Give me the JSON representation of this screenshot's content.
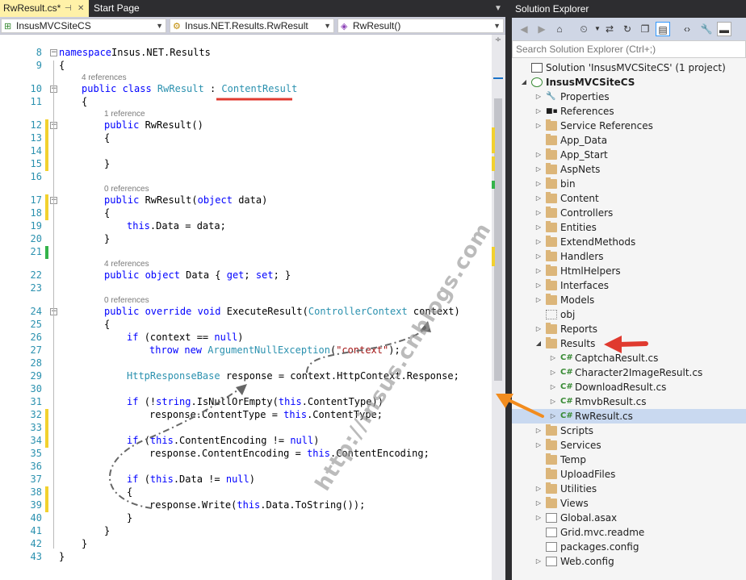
{
  "tabs": [
    {
      "label": "RwResult.cs*"
    },
    {
      "label": "Start Page"
    }
  ],
  "nav": {
    "project": "InsusMVCSiteCS",
    "class": "Insus.NET.Results.RwResult",
    "member": "RwResult()"
  },
  "code": [
    {
      "n": "8",
      "ind": 0,
      "seg": [
        [
          "kw",
          "namespace"
        ],
        [
          "",
          "Insus.NET.Results"
        ]
      ]
    },
    {
      "n": "9",
      "ind": 0,
      "seg": [
        [
          "",
          "{"
        ]
      ]
    },
    {
      "ref": "4 references",
      "ind": 1
    },
    {
      "n": "10",
      "ind": 1,
      "seg": [
        [
          "kw",
          "public class "
        ],
        [
          "ty",
          "RwResult"
        ],
        [
          "",
          " : "
        ],
        [
          "ty",
          "ContentResult"
        ]
      ]
    },
    {
      "n": "11",
      "ind": 1,
      "seg": [
        [
          "",
          "{"
        ]
      ]
    },
    {
      "ref": "1 reference",
      "ind": 2
    },
    {
      "n": "12",
      "ind": 2,
      "seg": [
        [
          "kw",
          "public "
        ],
        [
          "",
          "RwResult()"
        ]
      ]
    },
    {
      "n": "13",
      "ind": 2,
      "seg": [
        [
          "",
          "{"
        ]
      ]
    },
    {
      "n": "14",
      "ind": 2,
      "seg": []
    },
    {
      "n": "15",
      "ind": 2,
      "seg": [
        [
          "",
          "}"
        ]
      ]
    },
    {
      "n": "16",
      "ind": 2,
      "seg": []
    },
    {
      "ref": "0 references",
      "ind": 2
    },
    {
      "n": "17",
      "ind": 2,
      "seg": [
        [
          "kw",
          "public "
        ],
        [
          "",
          "RwResult("
        ],
        [
          "kw",
          "object"
        ],
        [
          "",
          " data)"
        ]
      ]
    },
    {
      "n": "18",
      "ind": 2,
      "seg": [
        [
          "",
          "{"
        ]
      ]
    },
    {
      "n": "19",
      "ind": 3,
      "seg": [
        [
          "kw",
          "this"
        ],
        [
          "",
          ".Data = data;"
        ]
      ]
    },
    {
      "n": "20",
      "ind": 2,
      "seg": [
        [
          "",
          "}"
        ]
      ]
    },
    {
      "n": "21",
      "ind": 2,
      "seg": []
    },
    {
      "ref": "4 references",
      "ind": 2
    },
    {
      "n": "22",
      "ind": 2,
      "seg": [
        [
          "kw",
          "public object "
        ],
        [
          "",
          "Data { "
        ],
        [
          "kw",
          "get"
        ],
        [
          "",
          "; "
        ],
        [
          "kw",
          "set"
        ],
        [
          "",
          "; }"
        ]
      ]
    },
    {
      "n": "23",
      "ind": 2,
      "seg": []
    },
    {
      "ref": "0 references",
      "ind": 2
    },
    {
      "n": "24",
      "ind": 2,
      "seg": [
        [
          "kw",
          "public override void "
        ],
        [
          "",
          "ExecuteResult("
        ],
        [
          "ty",
          "ControllerContext"
        ],
        [
          "",
          " context)"
        ]
      ]
    },
    {
      "n": "25",
      "ind": 2,
      "seg": [
        [
          "",
          "{"
        ]
      ]
    },
    {
      "n": "26",
      "ind": 3,
      "seg": [
        [
          "kw",
          "if "
        ],
        [
          "",
          "(context == "
        ],
        [
          "kw",
          "null"
        ],
        [
          "",
          ")"
        ]
      ]
    },
    {
      "n": "27",
      "ind": 4,
      "seg": [
        [
          "kw",
          "throw new "
        ],
        [
          "ty",
          "ArgumentNullException"
        ],
        [
          "",
          "("
        ],
        [
          "st",
          "\"context\""
        ],
        [
          "",
          ");"
        ]
      ]
    },
    {
      "n": "28",
      "ind": 3,
      "seg": []
    },
    {
      "n": "29",
      "ind": 3,
      "seg": [
        [
          "ty",
          "HttpResponseBase"
        ],
        [
          "",
          " response = context.HttpContext.Response;"
        ]
      ]
    },
    {
      "n": "30",
      "ind": 3,
      "seg": []
    },
    {
      "n": "31",
      "ind": 3,
      "seg": [
        [
          "kw",
          "if "
        ],
        [
          "",
          "(!"
        ],
        [
          "kw",
          "string"
        ],
        [
          "",
          ".IsNullOrEmpty("
        ],
        [
          "kw",
          "this"
        ],
        [
          "",
          ".ContentType))"
        ]
      ]
    },
    {
      "n": "32",
      "ind": 4,
      "seg": [
        [
          "",
          "response.ContentType = "
        ],
        [
          "kw",
          "this"
        ],
        [
          "",
          ".ContentType;"
        ]
      ]
    },
    {
      "n": "33",
      "ind": 3,
      "seg": []
    },
    {
      "n": "34",
      "ind": 3,
      "seg": [
        [
          "kw",
          "if "
        ],
        [
          "",
          "("
        ],
        [
          "kw",
          "this"
        ],
        [
          "",
          ".ContentEncoding != "
        ],
        [
          "kw",
          "null"
        ],
        [
          "",
          ")"
        ]
      ]
    },
    {
      "n": "35",
      "ind": 4,
      "seg": [
        [
          "",
          "response.ContentEncoding = "
        ],
        [
          "kw",
          "this"
        ],
        [
          "",
          ".ContentEncoding;"
        ]
      ]
    },
    {
      "n": "36",
      "ind": 3,
      "seg": []
    },
    {
      "n": "37",
      "ind": 3,
      "seg": [
        [
          "kw",
          "if "
        ],
        [
          "",
          "("
        ],
        [
          "kw",
          "this"
        ],
        [
          "",
          ".Data != "
        ],
        [
          "kw",
          "null"
        ],
        [
          "",
          ")"
        ]
      ]
    },
    {
      "n": "38",
      "ind": 3,
      "seg": [
        [
          "",
          "{"
        ]
      ]
    },
    {
      "n": "39",
      "ind": 4,
      "seg": [
        [
          "",
          "response.Write("
        ],
        [
          "kw",
          "this"
        ],
        [
          "",
          ".Data.ToString());"
        ]
      ]
    },
    {
      "n": "40",
      "ind": 3,
      "seg": [
        [
          "",
          "}"
        ]
      ]
    },
    {
      "n": "41",
      "ind": 2,
      "seg": [
        [
          "",
          "}"
        ]
      ]
    },
    {
      "n": "42",
      "ind": 1,
      "seg": [
        [
          "",
          "}"
        ]
      ]
    },
    {
      "n": "43",
      "ind": 0,
      "seg": [
        [
          "",
          "}"
        ]
      ]
    }
  ],
  "solution_explorer": {
    "title": "Solution Explorer",
    "search_placeholder": "Search Solution Explorer (Ctrl+;)",
    "items": [
      {
        "label": "Solution 'InsusMVCSiteCS' (1 project)",
        "level": 0,
        "icon": "solution-icon",
        "exp": ""
      },
      {
        "label": "InsusMVCSiteCS",
        "level": 1,
        "icon": "project-icon",
        "exp": "open",
        "bold": true
      },
      {
        "label": "Properties",
        "level": 2,
        "icon": "wrench-icon",
        "exp": "closed"
      },
      {
        "label": "References",
        "level": 2,
        "icon": "references-icon",
        "exp": "closed"
      },
      {
        "label": "Service References",
        "level": 2,
        "icon": "folder-icon",
        "exp": "closed"
      },
      {
        "label": "App_Data",
        "level": 2,
        "icon": "folder-icon",
        "exp": ""
      },
      {
        "label": "App_Start",
        "level": 2,
        "icon": "folder-icon",
        "exp": "closed"
      },
      {
        "label": "AspNets",
        "level": 2,
        "icon": "folder-icon",
        "exp": "closed"
      },
      {
        "label": "bin",
        "level": 2,
        "icon": "folder-icon",
        "exp": "closed"
      },
      {
        "label": "Content",
        "level": 2,
        "icon": "folder-icon",
        "exp": "closed"
      },
      {
        "label": "Controllers",
        "level": 2,
        "icon": "folder-icon",
        "exp": "closed"
      },
      {
        "label": "Entities",
        "level": 2,
        "icon": "folder-icon",
        "exp": "closed"
      },
      {
        "label": "ExtendMethods",
        "level": 2,
        "icon": "folder-icon",
        "exp": "closed"
      },
      {
        "label": "Handlers",
        "level": 2,
        "icon": "folder-icon",
        "exp": "closed"
      },
      {
        "label": "HtmlHelpers",
        "level": 2,
        "icon": "folder-icon",
        "exp": "closed"
      },
      {
        "label": "Interfaces",
        "level": 2,
        "icon": "folder-icon",
        "exp": "closed"
      },
      {
        "label": "Models",
        "level": 2,
        "icon": "folder-icon",
        "exp": "closed"
      },
      {
        "label": "obj",
        "level": 2,
        "icon": "dotted-folder-icon",
        "exp": ""
      },
      {
        "label": "Reports",
        "level": 2,
        "icon": "folder-icon",
        "exp": "closed"
      },
      {
        "label": "Results",
        "level": 2,
        "icon": "folder-open-icon",
        "exp": "open"
      },
      {
        "label": "CaptchaResult.cs",
        "level": 3,
        "icon": "csharp-file-icon",
        "exp": "closed"
      },
      {
        "label": "Character2ImageResult.cs",
        "level": 3,
        "icon": "csharp-file-icon",
        "exp": "closed"
      },
      {
        "label": "DownloadResult.cs",
        "level": 3,
        "icon": "csharp-file-icon",
        "exp": "closed"
      },
      {
        "label": "RmvbResult.cs",
        "level": 3,
        "icon": "csharp-file-icon",
        "exp": "closed"
      },
      {
        "label": "RwResult.cs",
        "level": 3,
        "icon": "csharp-file-icon",
        "exp": "closed",
        "selected": true
      },
      {
        "label": "Scripts",
        "level": 2,
        "icon": "folder-icon",
        "exp": "closed"
      },
      {
        "label": "Services",
        "level": 2,
        "icon": "folder-icon",
        "exp": "closed"
      },
      {
        "label": "Temp",
        "level": 2,
        "icon": "folder-icon",
        "exp": ""
      },
      {
        "label": "UploadFiles",
        "level": 2,
        "icon": "folder-icon",
        "exp": ""
      },
      {
        "label": "Utilities",
        "level": 2,
        "icon": "folder-icon",
        "exp": "closed"
      },
      {
        "label": "Views",
        "level": 2,
        "icon": "folder-icon",
        "exp": "closed"
      },
      {
        "label": "Global.asax",
        "level": 2,
        "icon": "asax-icon",
        "exp": "closed"
      },
      {
        "label": "Grid.mvc.readme",
        "level": 2,
        "icon": "text-file-icon",
        "exp": ""
      },
      {
        "label": "packages.config",
        "level": 2,
        "icon": "config-file-icon",
        "exp": ""
      },
      {
        "label": "Web.config",
        "level": 2,
        "icon": "config-file-icon",
        "exp": "closed"
      }
    ]
  },
  "watermark": "http://insus.cnblogs.com",
  "colors": {
    "keyword": "#0000ff",
    "type": "#2b91af",
    "string": "#a31515",
    "changed": "#f2d12e",
    "saved": "#34b34a",
    "arrow_red": "#e03a2f",
    "arrow_orange": "#f28c1e"
  }
}
